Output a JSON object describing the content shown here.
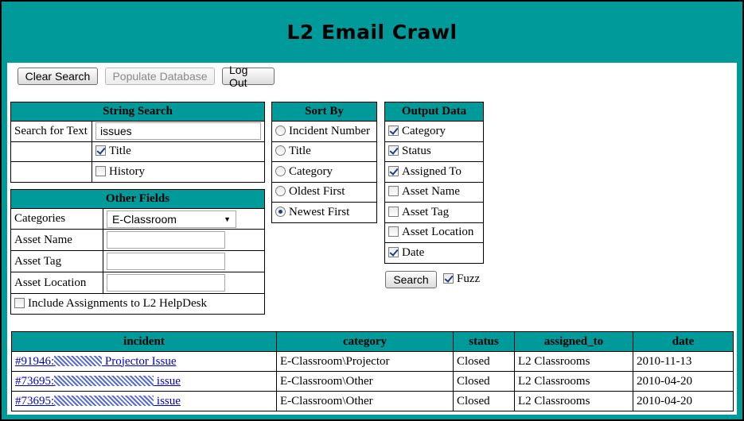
{
  "app_title": "L2 Email Crawl",
  "toolbar": {
    "clear_search": "Clear Search",
    "populate_database": "Populate Database",
    "log_out": "Log Out"
  },
  "string_search": {
    "header": "String Search",
    "search_label": "Search for Text",
    "search_value": "issues",
    "title_label": "Title",
    "title_checked": true,
    "history_label": "History",
    "history_checked": false
  },
  "other_fields": {
    "header": "Other Fields",
    "categories_label": "Categories",
    "categories_value": "E-Classroom",
    "asset_name_label": "Asset Name",
    "asset_tag_label": "Asset Tag",
    "asset_location_label": "Asset Location",
    "include_label": "Include Assignments to L2 HelpDesk",
    "include_checked": false
  },
  "sort_by": {
    "header": "Sort By",
    "options": [
      "Incident Number",
      "Title",
      "Category",
      "Oldest First",
      "Newest First"
    ],
    "selected": "Newest First"
  },
  "output_data": {
    "header": "Output Data",
    "options": [
      {
        "label": "Category",
        "checked": true
      },
      {
        "label": "Status",
        "checked": true
      },
      {
        "label": "Assigned To",
        "checked": true
      },
      {
        "label": "Asset Name",
        "checked": false
      },
      {
        "label": "Asset Tag",
        "checked": false
      },
      {
        "label": "Asset Location",
        "checked": false
      },
      {
        "label": "Date",
        "checked": true
      }
    ],
    "search_button": "Search",
    "fuzz_label": "Fuzz",
    "fuzz_checked": true
  },
  "results": {
    "columns": [
      "incident",
      "category",
      "status",
      "assigned_to",
      "date"
    ],
    "rows": [
      {
        "incident_prefix": "#91946:",
        "incident_suffix": " Projector Issue",
        "category": "E-Classroom\\Projector",
        "status": "Closed",
        "assigned_to": "L2 Classrooms",
        "date": "2010-11-13"
      },
      {
        "incident_prefix": "#73695:",
        "incident_suffix": " issue",
        "category": "E-Classroom\\Other",
        "status": "Closed",
        "assigned_to": "L2 Classrooms",
        "date": "2010-04-20"
      },
      {
        "incident_prefix": "#73695:",
        "incident_suffix": " issue",
        "category": "E-Classroom\\Other",
        "status": "Closed",
        "assigned_to": "L2 Classrooms",
        "date": "2010-04-20"
      }
    ]
  }
}
